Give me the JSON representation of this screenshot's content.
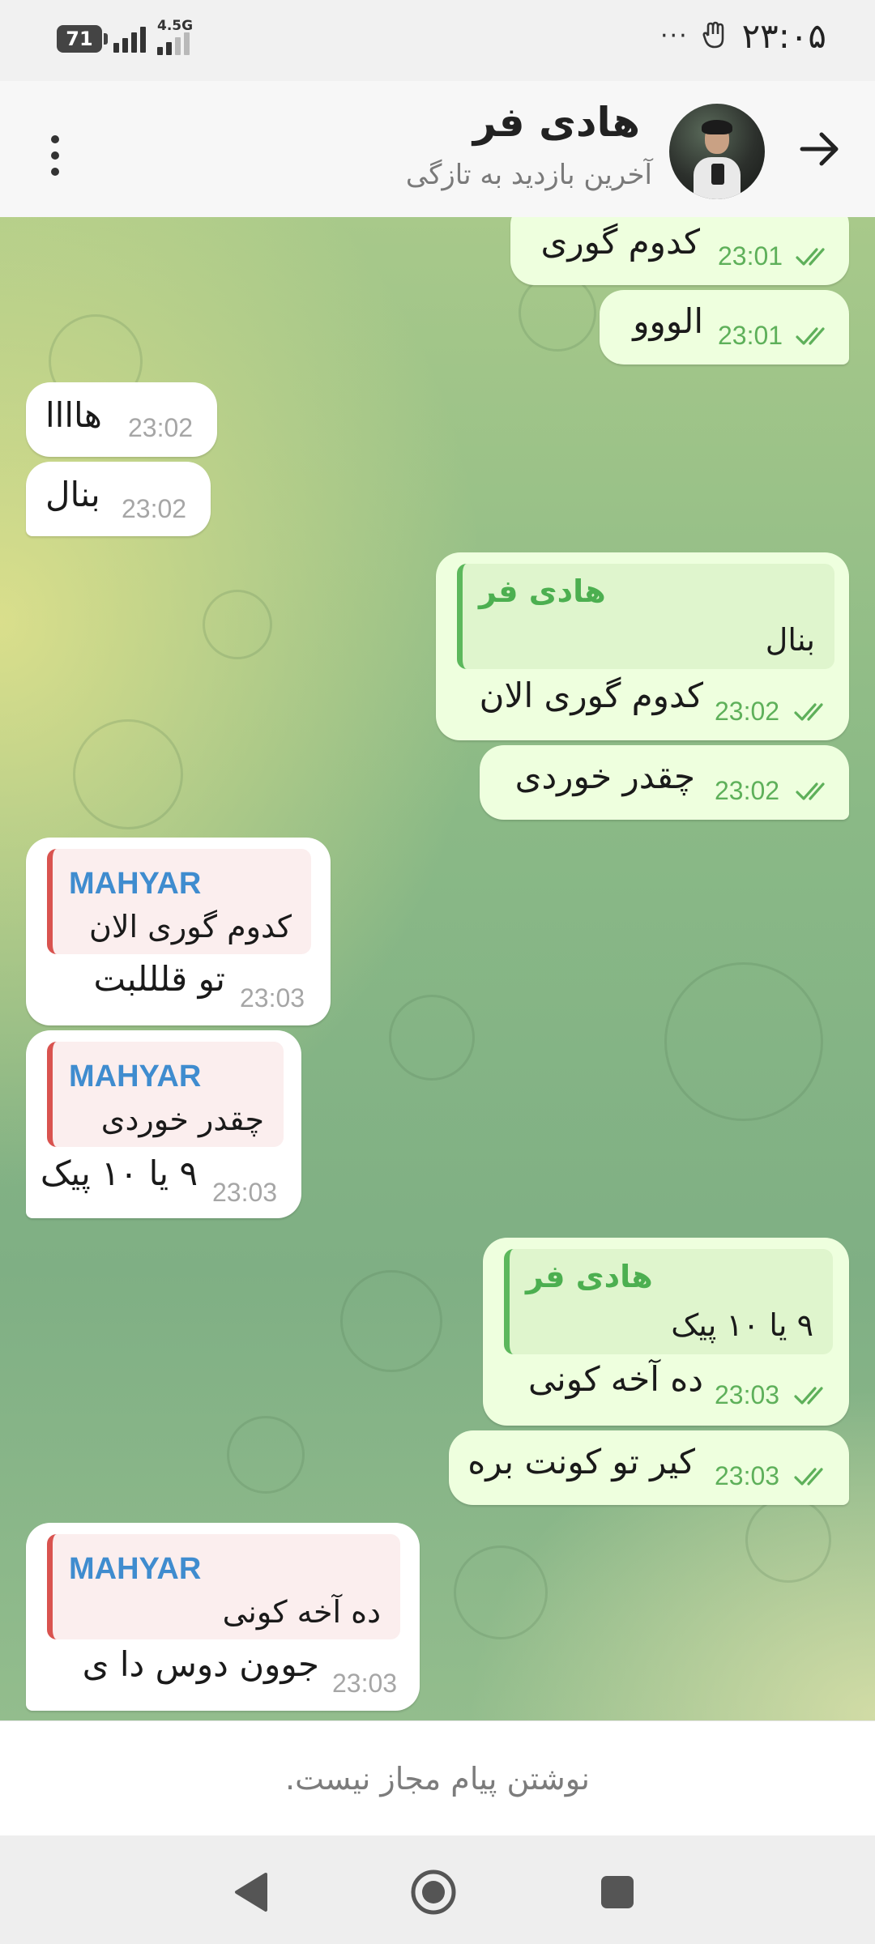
{
  "status_bar": {
    "battery": "71",
    "network": "4.5G",
    "time": "۲۳:۰۵",
    "overflow": "···"
  },
  "header": {
    "title": "هادی فر",
    "status": "آخرین بازدید به تازگی",
    "back_icon": "arrow-right-icon",
    "menu_icon": "more-vertical-icon"
  },
  "messages": [
    {
      "dir": "out",
      "text": "کدوم گوری",
      "time": "23:01",
      "read": true
    },
    {
      "dir": "out",
      "text": "الووو",
      "time": "23:01",
      "read": true
    },
    {
      "dir": "in",
      "text": "هاااا",
      "time": "23:02"
    },
    {
      "dir": "in",
      "text": "بنال",
      "time": "23:02"
    },
    {
      "dir": "out",
      "reply": {
        "name": "هادی فر",
        "text": "بنال"
      },
      "text": "کدوم گوری الان",
      "time": "23:02",
      "read": true
    },
    {
      "dir": "out",
      "text": "چقدر خوردی",
      "time": "23:02",
      "read": true
    },
    {
      "dir": "in",
      "reply": {
        "name": "MAHYAR",
        "text": "کدوم گوری الان"
      },
      "text": "تو قلللبت",
      "time": "23:03"
    },
    {
      "dir": "in",
      "reply": {
        "name": "MAHYAR",
        "text": "چقدر خوردی"
      },
      "text": "۹ یا ۱۰ پیک",
      "time": "23:03"
    },
    {
      "dir": "out",
      "reply": {
        "name": "هادی فر",
        "text": "۹ یا ۱۰ پیک"
      },
      "text": "ده آخه کونی",
      "time": "23:03",
      "read": true
    },
    {
      "dir": "out",
      "text": "کیر تو کونت بره",
      "time": "23:03",
      "read": true
    },
    {
      "dir": "in",
      "reply": {
        "name": "MAHYAR",
        "text": "ده آخه کونی"
      },
      "text": "جوون دوس دا ی",
      "time": "23:03"
    }
  ],
  "composer_notice": "نوشتن پیام مجاز نیست.",
  "nav_bar": {
    "back_icon": "nav-back-icon",
    "home_icon": "nav-home-icon",
    "recents_icon": "nav-recents-icon"
  },
  "colors": {
    "outgoing_bubble": "#eeffde",
    "incoming_bubble": "#ffffff",
    "outgoing_accent": "#5cb85c",
    "incoming_reply_accent": "#d9534f",
    "incoming_name": "#3f8ccf"
  }
}
